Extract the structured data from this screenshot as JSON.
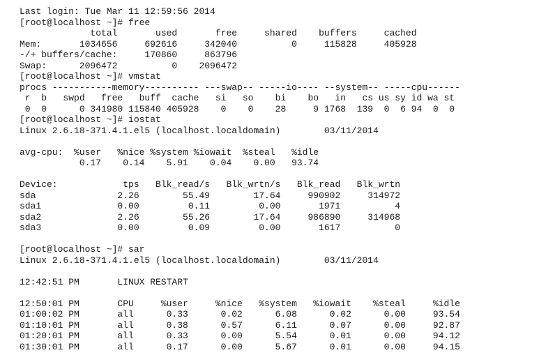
{
  "terminal": {
    "lines": [
      "Last login: Tue Mar 11 12:59:56 2014",
      "[root@localhost ~]# free",
      "             total       used       free     shared    buffers     cached",
      "Mem:       1034656     692616     342040          0     115828     405928",
      "-/+ buffers/cache:     170860     863796",
      "Swap:      2096472          0    2096472",
      "[root@localhost ~]# vmstat",
      "procs -----------memory---------- ---swap-- -----io---- --system-- -----cpu------",
      " r  b   swpd   free   buff  cache   si   so    bi    bo   in   cs us sy id wa st",
      " 0  0      0 341980 115840 405928    0    0    28     9 1768  139  0  6 94  0  0",
      "[root@localhost ~]# iostat",
      "Linux 2.6.18-371.4.1.el5 (localhost.localdomain)        03/11/2014",
      "",
      "avg-cpu:  %user   %nice %system %iowait  %steal   %idle",
      "           0.17    0.14    5.91    0.04    0.00   93.74",
      "",
      "Device:            tps   Blk_read/s   Blk_wrtn/s   Blk_read   Blk_wrtn",
      "sda               2.26        55.49        17.64     990902     314972",
      "sda1              0.00         0.11         0.00       1971          4",
      "sda2              2.26        55.26        17.64     986890     314968",
      "sda3              0.00         0.09         0.00       1617          0",
      "",
      "[root@localhost ~]# sar",
      "Linux 2.6.18-371.4.1.el5 (localhost.localdomain)        03/11/2014",
      "",
      "12:42:51 PM       LINUX RESTART",
      "",
      "12:50:01 PM       CPU     %user     %nice   %system   %iowait    %steal     %idle",
      "01:00:02 PM       all      0.33      0.02      6.08      0.02      0.00     93.54",
      "01:10:01 PM       all      0.38      0.57      6.11      0.07      0.00     92.87",
      "01:20:01 PM       all      0.33      0.00      5.54      0.01      0.00     94.12",
      "01:30:01 PM       all      0.17      0.00      5.67      0.01      0.00     94.15"
    ]
  }
}
